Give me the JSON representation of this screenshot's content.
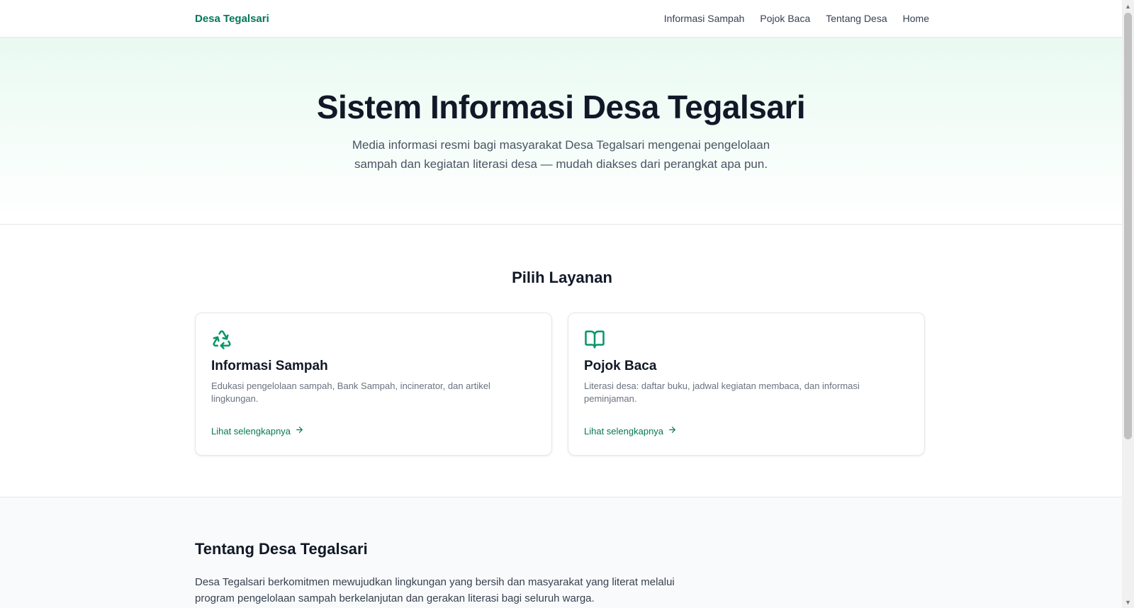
{
  "nav": {
    "brand": "Desa Tegalsari",
    "links": [
      "Informasi Sampah",
      "Pojok Baca",
      "Tentang Desa",
      "Home"
    ]
  },
  "hero": {
    "title": "Sistem Informasi Desa Tegalsari",
    "subtitle": "Media informasi resmi bagi masyarakat Desa Tegalsari mengenai pengelolaan sampah dan kegiatan literasi desa — mudah diakses dari perangkat apa pun."
  },
  "services": {
    "heading": "Pilih Layanan",
    "cards": [
      {
        "icon": "recycle-icon",
        "title": "Informasi Sampah",
        "description": "Edukasi pengelolaan sampah, Bank Sampah, incinerator, dan artikel lingkungan.",
        "link": "Lihat selengkapnya"
      },
      {
        "icon": "book-open-icon",
        "title": "Pojok Baca",
        "description": "Literasi desa: daftar buku, jadwal kegiatan membaca, dan informasi peminjaman.",
        "link": "Lihat selengkapnya"
      }
    ]
  },
  "about": {
    "heading": "Tentang Desa Tegalsari",
    "text": "Desa Tegalsari berkomitmen mewujudkan lingkungan yang bersih dan masyarakat yang literat melalui program pengelolaan sampah berkelanjutan dan gerakan literasi bagi seluruh warga."
  },
  "colors": {
    "accent": "#047857",
    "icon": "#059669"
  }
}
